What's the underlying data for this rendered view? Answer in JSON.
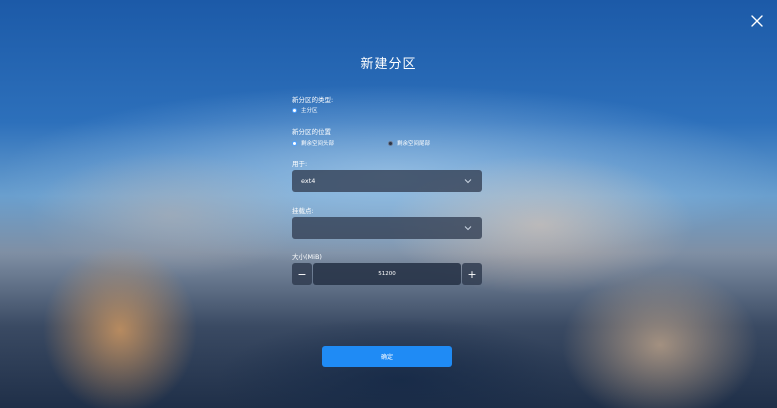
{
  "dialog": {
    "title": "新建分区",
    "close_icon": "close-icon"
  },
  "partition_type": {
    "label": "新分区的类型:",
    "options": [
      {
        "label": "主分区",
        "selected": true
      }
    ]
  },
  "partition_location": {
    "label": "新分区的位置",
    "options": [
      {
        "label": "剩余空间头部",
        "selected": true
      },
      {
        "label": "剩余空间尾部",
        "selected": false
      }
    ]
  },
  "filesystem": {
    "label": "用于:",
    "value": "ext4",
    "icon": "chevron-down-icon"
  },
  "mount_point": {
    "label": "挂载点:",
    "value": "",
    "icon": "chevron-down-icon"
  },
  "size": {
    "label": "大小(MiB)",
    "value": "51200",
    "decrement": "−",
    "increment": "+"
  },
  "confirm_button": "确定",
  "colors": {
    "accent": "#1f8bf5",
    "field_bg": "#323e52"
  }
}
